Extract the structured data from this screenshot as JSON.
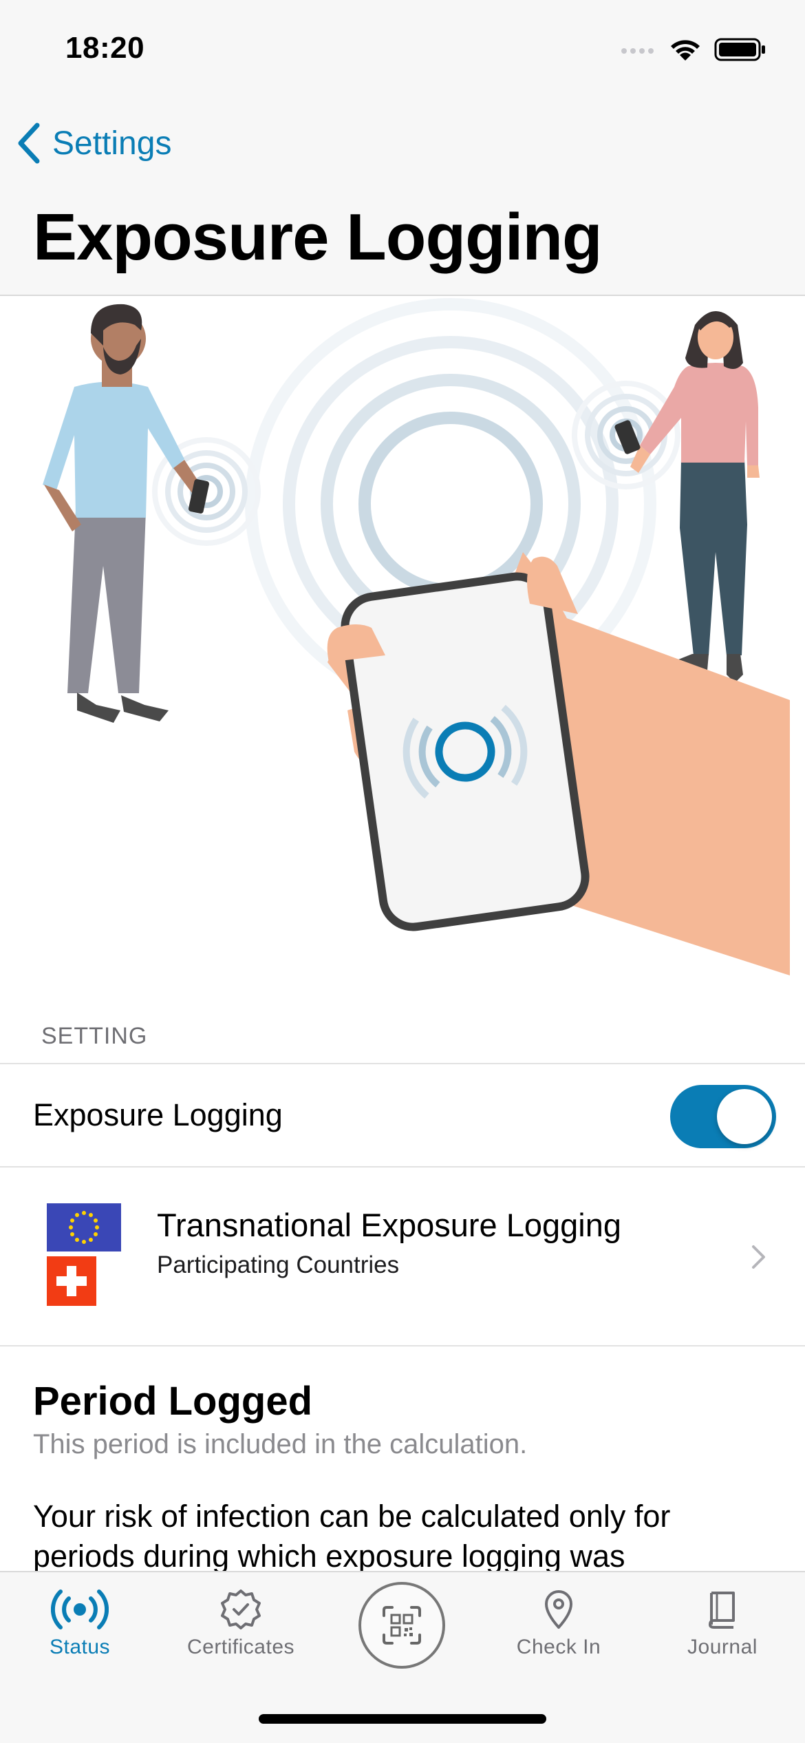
{
  "status_bar": {
    "time": "18:20"
  },
  "nav": {
    "back_label": "Settings",
    "title": "Exposure Logging"
  },
  "setting_section": {
    "caption": "SETTING",
    "toggle_label": "Exposure Logging",
    "toggle_on": true
  },
  "transnational": {
    "title": "Transnational Exposure Logging",
    "subtitle": "Participating Countries"
  },
  "period": {
    "title": "Period Logged",
    "subtitle": "This period is included in the calculation.",
    "body": "Your risk of infection can be calculated only for periods during which exposure logging was"
  },
  "tabs": [
    {
      "label": "Status",
      "icon": "status-broadcast-icon",
      "active": true
    },
    {
      "label": "Certificates",
      "icon": "certificate-badge-icon",
      "active": false
    },
    {
      "label": "",
      "icon": "qr-scan-icon",
      "active": false
    },
    {
      "label": "Check In",
      "icon": "location-pin-icon",
      "active": false
    },
    {
      "label": "Journal",
      "icon": "journal-book-icon",
      "active": false
    }
  ],
  "colors": {
    "accent": "#0a7db5",
    "header_bg": "#f7f7f7",
    "hand": "#f5b896",
    "swiss_red": "#f23c14",
    "eu_blue": "#3a47b6"
  }
}
